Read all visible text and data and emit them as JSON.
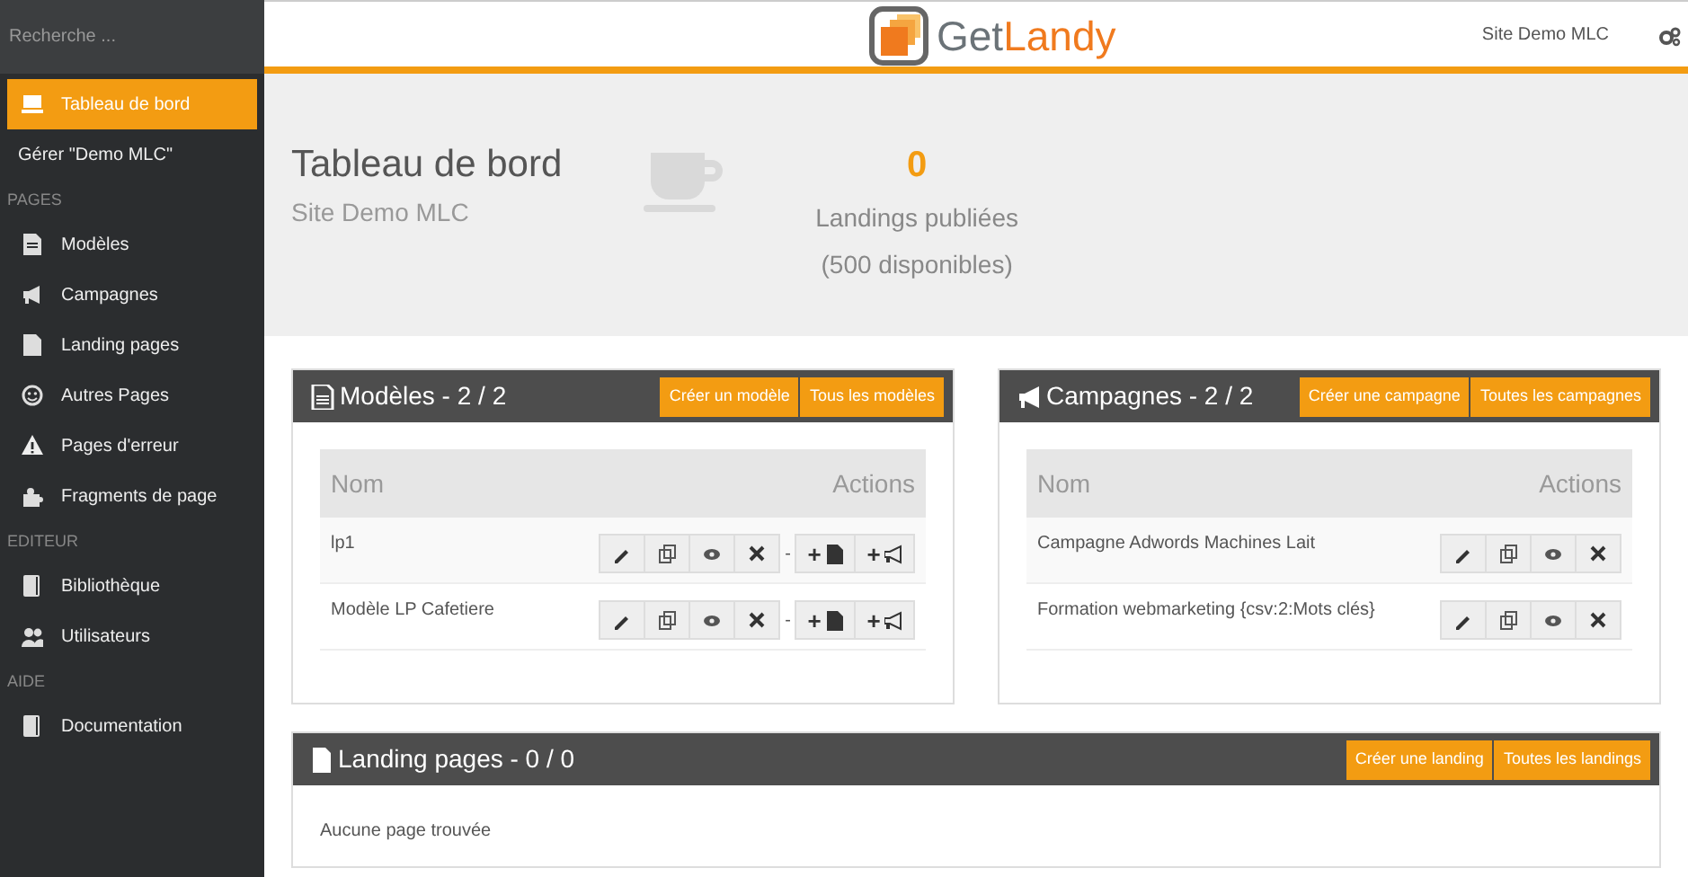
{
  "sidebar": {
    "search": {
      "placeholder": "Recherche ..."
    },
    "items": [
      {
        "kind": "nav",
        "label": "Tableau de bord",
        "selected": true
      },
      {
        "kind": "manage",
        "label": "Gérer \"Demo MLC\"",
        "selected": false
      },
      {
        "kind": "heading",
        "label": "PAGES"
      },
      {
        "kind": "nav",
        "label": "Modèles",
        "selected": false
      },
      {
        "kind": "nav",
        "label": "Campagnes",
        "selected": false
      },
      {
        "kind": "nav",
        "label": "Landing pages",
        "selected": false
      },
      {
        "kind": "nav",
        "label": "Autres Pages",
        "selected": false
      },
      {
        "kind": "nav",
        "label": "Pages d'erreur",
        "selected": false
      },
      {
        "kind": "nav",
        "label": "Fragments de page",
        "selected": false
      },
      {
        "kind": "heading",
        "label": "EDITEUR"
      },
      {
        "kind": "nav",
        "label": "Bibliothèque",
        "selected": false
      },
      {
        "kind": "nav",
        "label": "Utilisateurs",
        "selected": false
      },
      {
        "kind": "heading",
        "label": "AIDE"
      },
      {
        "kind": "nav",
        "label": "Documentation",
        "selected": false
      }
    ]
  },
  "header": {
    "logo": {
      "part_1": "Get",
      "part_2": "Landy"
    },
    "site": "Site Demo MLC"
  },
  "dashboard": {
    "title": "Tableau de bord",
    "subtitle": "Site Demo MLC",
    "count": "0",
    "count_label": "Landings publiées",
    "available": "(500 disponibles)"
  },
  "panels": [
    {
      "title": "Modèles - 2 / 2",
      "buttons": [
        "Créer un modèle",
        "Tous les modèles"
      ],
      "columns": [
        "Nom",
        "Actions"
      ],
      "actions": [
        {
          "kind": "edit"
        },
        {
          "kind": "copy"
        },
        {
          "kind": "view"
        },
        {
          "kind": "delete"
        },
        {
          "kind": "separator",
          "text": "-"
        },
        {
          "kind": "add_page",
          "text": "+"
        },
        {
          "kind": "add_campaign",
          "text": "+"
        }
      ],
      "rows": [
        "lp1",
        "Modèle LP Cafetiere"
      ]
    },
    {
      "title": "Campagnes - 2 / 2",
      "buttons": [
        "Créer une campagne",
        "Toutes les campagnes"
      ],
      "columns": [
        "Nom",
        "Actions"
      ],
      "actions": [
        {
          "kind": "edit"
        },
        {
          "kind": "copy"
        },
        {
          "kind": "view"
        },
        {
          "kind": "delete"
        }
      ],
      "rows": [
        "Campagne Adwords Machines Lait",
        "Formation webmarketing {csv:2:Mots clés}"
      ]
    }
  ],
  "landing_panel": {
    "title": "Landing pages - 0 / 0",
    "buttons": [
      "Créer une landing",
      "Toutes les landings"
    ],
    "empty": "Aucune page trouvée"
  }
}
